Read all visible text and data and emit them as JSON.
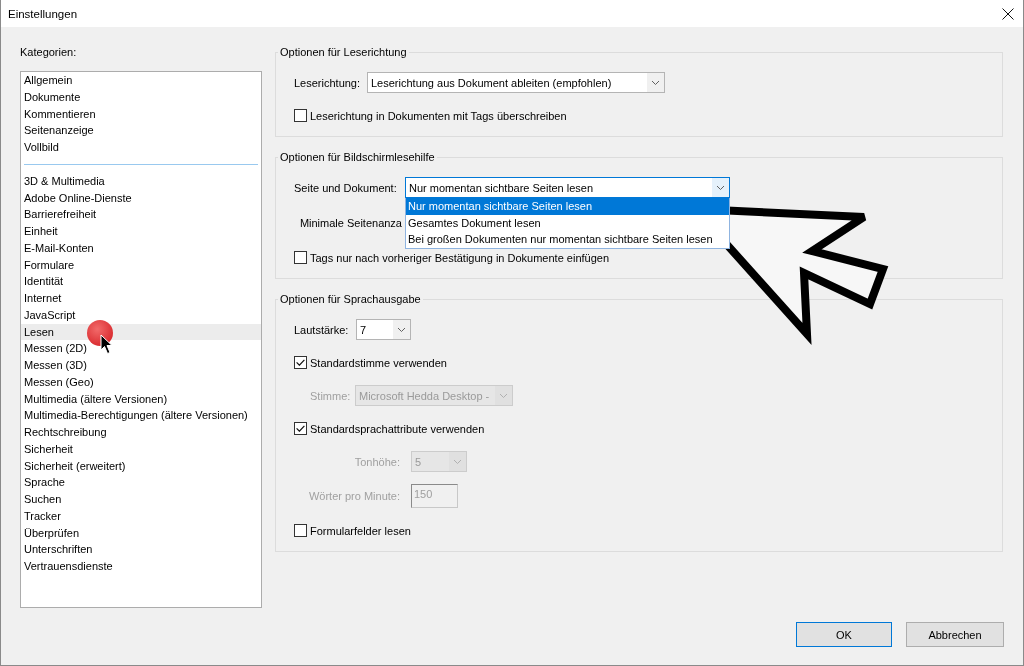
{
  "window": {
    "title": "Einstellungen"
  },
  "categories": {
    "label": "Kategorien:",
    "groups": [
      {
        "items": [
          {
            "label": "Allgemein",
            "selected": false
          },
          {
            "label": "Dokumente",
            "selected": false
          },
          {
            "label": "Kommentieren",
            "selected": false
          },
          {
            "label": "Seitenanzeige",
            "selected": false
          },
          {
            "label": "Vollbild",
            "selected": false
          }
        ]
      },
      {
        "items": [
          {
            "label": "3D & Multimedia",
            "selected": false
          },
          {
            "label": "Adobe Online-Dienste",
            "selected": false
          },
          {
            "label": "Barrierefreiheit",
            "selected": false
          },
          {
            "label": "Einheit",
            "selected": false
          },
          {
            "label": "E-Mail-Konten",
            "selected": false
          },
          {
            "label": "Formulare",
            "selected": false
          },
          {
            "label": "Identität",
            "selected": false
          },
          {
            "label": "Internet",
            "selected": false
          },
          {
            "label": "JavaScript",
            "selected": false
          },
          {
            "label": "Lesen",
            "selected": true
          },
          {
            "label": "Messen (2D)",
            "selected": false
          },
          {
            "label": "Messen (3D)",
            "selected": false
          },
          {
            "label": "Messen (Geo)",
            "selected": false
          },
          {
            "label": "Multimedia (ältere Versionen)",
            "selected": false
          },
          {
            "label": "Multimedia-Berechtigungen (ältere Versionen)",
            "selected": false
          },
          {
            "label": "Rechtschreibung",
            "selected": false
          },
          {
            "label": "Sicherheit",
            "selected": false
          },
          {
            "label": "Sicherheit (erweitert)",
            "selected": false
          },
          {
            "label": "Sprache",
            "selected": false
          },
          {
            "label": "Suchen",
            "selected": false
          },
          {
            "label": "Tracker",
            "selected": false
          },
          {
            "label": "Überprüfen",
            "selected": false
          },
          {
            "label": "Unterschriften",
            "selected": false
          },
          {
            "label": "Vertrauensdienste",
            "selected": false
          }
        ]
      }
    ]
  },
  "sections": [
    {
      "title": "Optionen für Leserichtung",
      "rows": [
        {
          "kind": "select",
          "label": "Leserichtung:",
          "value": "Leserichtung aus Dokument ableiten (empfohlen)",
          "disabled": false,
          "expanded": false
        },
        {
          "kind": "checkbox",
          "label": "Leserichtung in Dokumenten mit Tags überschreiben",
          "checked": false,
          "disabled": false
        }
      ]
    },
    {
      "title": "Optionen für Bildschirmlesehilfe",
      "rows": [
        {
          "kind": "select",
          "label": "Seite und Dokument:",
          "value": "Nur momentan sichtbare Seiten lesen",
          "disabled": false,
          "expanded": true,
          "options": [
            {
              "label": "Nur momentan sichtbare Seiten lesen",
              "selected": true
            },
            {
              "label": "Gesamtes Dokument lesen",
              "selected": false
            },
            {
              "label": "Bei großen Dokumenten nur momentan sichtbare Seiten lesen",
              "selected": false
            }
          ]
        },
        {
          "kind": "label",
          "label": "Minimale Seitenanza",
          "disabled": false
        },
        {
          "kind": "checkbox",
          "label": "Tags nur nach vorheriger Bestätigung in Dokumente einfügen",
          "checked": false,
          "disabled": false
        }
      ]
    },
    {
      "title": "Optionen für Sprachausgabe",
      "rows": [
        {
          "kind": "select",
          "label": "Lautstärke:",
          "value": "7",
          "disabled": false,
          "expanded": false
        },
        {
          "kind": "checkbox",
          "label": "Standardstimme verwenden",
          "checked": true,
          "disabled": false
        },
        {
          "kind": "select",
          "label": "Stimme:",
          "value": "Microsoft Hedda Desktop -",
          "disabled": true,
          "expanded": false
        },
        {
          "kind": "checkbox",
          "label": "Standardsprachattribute verwenden",
          "checked": true,
          "disabled": false
        },
        {
          "kind": "select",
          "label": "Tonhöhe:",
          "value": "5",
          "disabled": true,
          "expanded": false
        },
        {
          "kind": "textfield",
          "label": "Wörter pro Minute:",
          "value": "150",
          "disabled": true
        },
        {
          "kind": "checkbox",
          "label": "Formularfelder lesen",
          "checked": false,
          "disabled": false
        }
      ]
    }
  ],
  "buttons": [
    {
      "label": "OK",
      "default": true
    },
    {
      "label": "Abbrechen",
      "default": false
    }
  ]
}
